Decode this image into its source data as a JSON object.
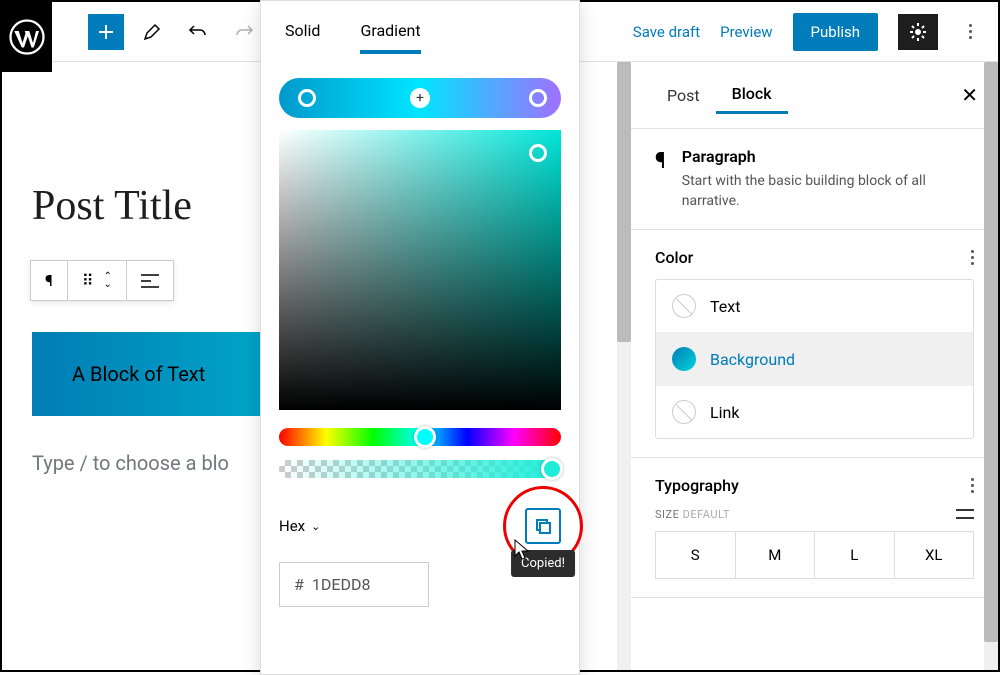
{
  "topbar": {
    "save_draft": "Save draft",
    "preview": "Preview",
    "publish": "Publish"
  },
  "editor": {
    "post_title": "Post Title",
    "block_text": "A Block of Text",
    "placeholder": "Type / to choose a blo"
  },
  "color_popover": {
    "solid_tab": "Solid",
    "gradient_tab": "Gradient",
    "format_label": "Hex",
    "hex_prefix": "#",
    "hex_value": "1DEDD8",
    "tooltip": "Copied!"
  },
  "sidebar": {
    "post_tab": "Post",
    "block_tab": "Block",
    "block_name": "Paragraph",
    "block_desc": "Start with the basic building block of all narrative.",
    "color_heading": "Color",
    "color_text": "Text",
    "color_background": "Background",
    "color_link": "Link",
    "typo_heading": "Typography",
    "size_label": "SIZE",
    "size_default": "DEFAULT",
    "sizes": {
      "s": "S",
      "m": "M",
      "l": "L",
      "xl": "XL"
    }
  }
}
